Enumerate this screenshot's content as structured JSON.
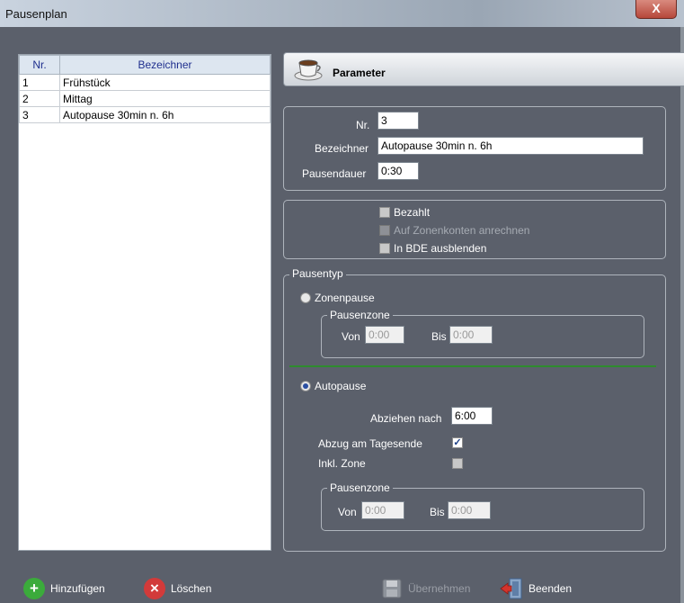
{
  "window": {
    "title": "Pausenplan",
    "close_label": "X"
  },
  "list": {
    "headers": [
      "Nr.",
      "Bezeichner"
    ],
    "rows": [
      {
        "nr": "1",
        "name": "Frühstück"
      },
      {
        "nr": "2",
        "name": "Mittag"
      },
      {
        "nr": "3",
        "name": "Autopause 30min n. 6h"
      }
    ]
  },
  "param": {
    "header": "Parameter",
    "nr_label": "Nr.",
    "nr_value": "3",
    "bez_label": "Bezeichner",
    "bez_value": "Autopause 30min n. 6h",
    "dauer_label": "Pausendauer",
    "dauer_value": "0:30"
  },
  "flags": {
    "bezahlt": "Bezahlt",
    "zonenkonten": "Auf Zonenkonten anrechnen",
    "bde": "In BDE ausblenden"
  },
  "pausentyp": {
    "legend": "Pausentyp",
    "zonenpause": "Zonenpause",
    "zone_legend": "Pausenzone",
    "von_label": "Von",
    "von_value": "0:00",
    "bis_label": "Bis",
    "bis_value": "0:00",
    "autopause": "Autopause",
    "abziehen_label": "Abziehen nach",
    "abziehen_value": "6:00",
    "tagesende_label": "Abzug am Tagesende",
    "inkl_zone_label": "Inkl. Zone",
    "zone2_legend": "Pausenzone",
    "von2_label": "Von",
    "von2_value": "0:00",
    "bis2_label": "Bis",
    "bis2_value": "0:00"
  },
  "buttons": {
    "add": "Hinzufügen",
    "delete": "Löschen",
    "apply": "Übernehmen",
    "exit": "Beenden"
  }
}
